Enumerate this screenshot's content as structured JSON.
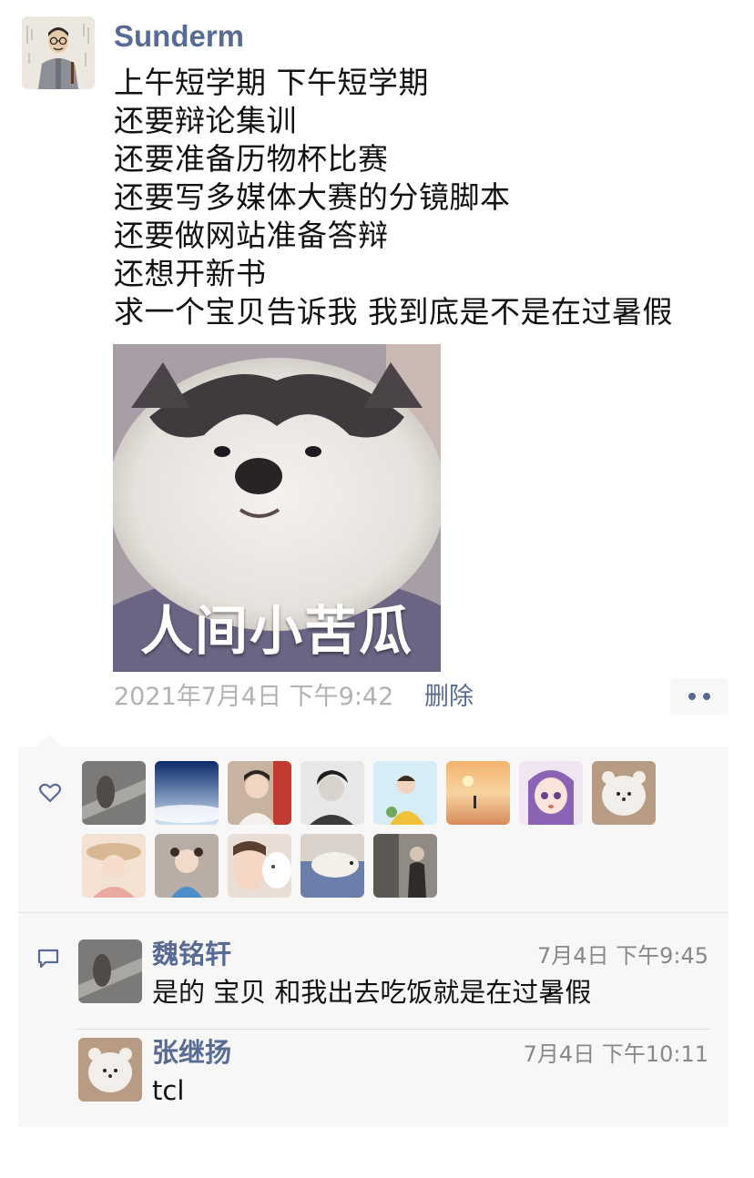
{
  "post": {
    "author": "Sunderm",
    "lines": [
      "上午短学期 下午短学期",
      "还要辩论集训",
      "还要准备历物杯比赛",
      "还要写多媒体大赛的分镜脚本",
      "还要做网站准备答辩",
      "还想开新书",
      "求一个宝贝告诉我 我到底是不是在过暑假"
    ],
    "image_caption": "人间小苦瓜",
    "timestamp": "2021年7月4日 下午9:42",
    "delete_label": "删除"
  },
  "likes": {
    "icon": "heart-outline-icon",
    "avatar_count": 13
  },
  "comments": [
    {
      "name": "魏铭轩",
      "time": "7月4日 下午9:45",
      "text": "是的 宝贝 和我出去吃饭就是在过暑假"
    },
    {
      "name": "张继扬",
      "time": "7月4日 下午10:11",
      "text": "tcl"
    }
  ],
  "colors": {
    "link": "#576b95",
    "panel_bg": "#f7f7f7",
    "timestamp": "#b2b2b2"
  }
}
